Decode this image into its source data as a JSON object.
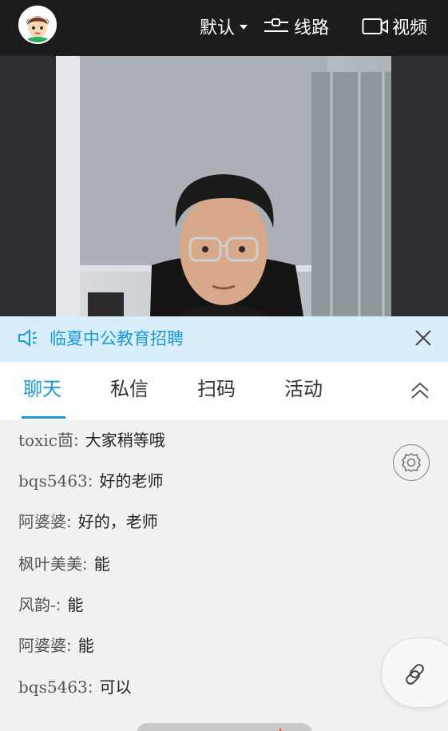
{
  "topbar": {
    "quality_label": "默认",
    "route_label": "线路",
    "video_label": "视频"
  },
  "notice": {
    "text": "临夏中公教育招聘"
  },
  "tabs": [
    {
      "label": "聊天",
      "active": true
    },
    {
      "label": "私信",
      "active": false
    },
    {
      "label": "扫码",
      "active": false
    },
    {
      "label": "活动",
      "active": false
    }
  ],
  "messages": [
    {
      "nick": "toxic茴",
      "text": "大家稍等哦"
    },
    {
      "nick": "bqs5463",
      "text": "好的老师"
    },
    {
      "nick": "阿婆婆",
      "text": "好的，老师"
    },
    {
      "nick": "枫叶美美",
      "text": "能"
    },
    {
      "nick": "风韵-",
      "text": "能"
    },
    {
      "nick": "阿婆婆",
      "text": "能"
    },
    {
      "nick": "bqs5463",
      "text": "可以"
    }
  ],
  "colors": {
    "accent": "#1a9ad6",
    "topbar": "#1c1c1f",
    "notice_bg": "#d8eefa"
  },
  "icons": {
    "settings": "gear-icon",
    "link": "link-icon",
    "close": "close-icon",
    "collapse": "chevron-up-double-icon"
  }
}
